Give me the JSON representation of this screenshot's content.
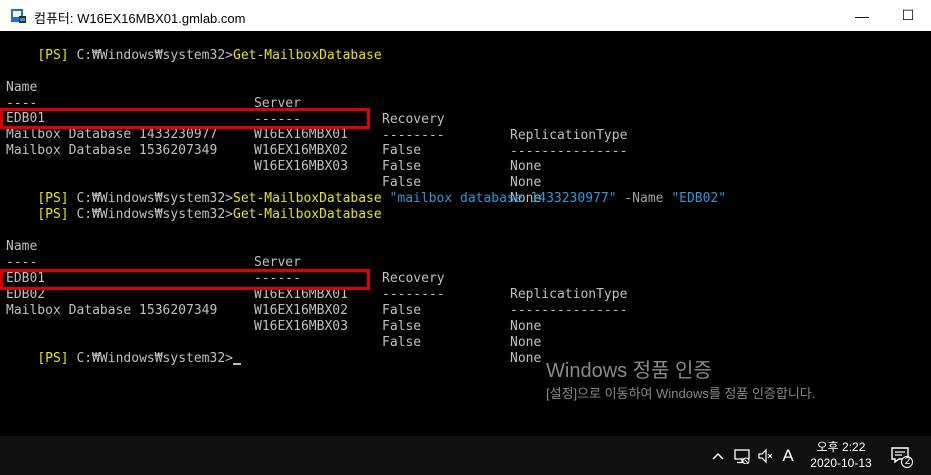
{
  "window": {
    "title": "컴퓨터: W16EX16MBX01.gmlab.com",
    "minimize_glyph": "—",
    "maximize_glyph": "☐"
  },
  "console": {
    "prompt_tag": "[PS]",
    "prompt_path": "C:₩Windows₩system32>",
    "commands": {
      "get_1": "Get-MailboxDatabase",
      "set_cmd": "Set-MailboxDatabase",
      "set_identity": "\"mailbox database 1433230977\"",
      "set_param": "-Name",
      "set_value": "\"EDB02\"",
      "get_2": "Get-MailboxDatabase"
    },
    "headers": {
      "name": "Name",
      "server": "Server",
      "recovery": "Recovery",
      "replication": "ReplicationType",
      "name_rule": "----",
      "server_rule": "------",
      "recovery_rule": "--------",
      "replication_rule": "---------------"
    },
    "table1": [
      {
        "name": "EDB01",
        "server": "W16EX16MBX01",
        "recovery": "False",
        "replication": "None"
      },
      {
        "name": "Mailbox Database 1433230977",
        "server": "W16EX16MBX02",
        "recovery": "False",
        "replication": "None"
      },
      {
        "name": "Mailbox Database 1536207349",
        "server": "W16EX16MBX03",
        "recovery": "False",
        "replication": "None"
      }
    ],
    "table2": [
      {
        "name": "EDB01",
        "server": "W16EX16MBX01",
        "recovery": "False",
        "replication": "None"
      },
      {
        "name": "EDB02",
        "server": "W16EX16MBX02",
        "recovery": "False",
        "replication": "None"
      },
      {
        "name": "Mailbox Database 1536207349",
        "server": "W16EX16MBX03",
        "recovery": "False",
        "replication": "None"
      }
    ],
    "highlight_color": "#e00000"
  },
  "watermark": {
    "title": "Windows 정품 인증",
    "subtitle": "[설정]으로 이동하여 Windows를 정품 인증합니다."
  },
  "taskbar": {
    "tray_chevron": "^",
    "ime_indicator": "A",
    "clock_time": "오후 2:22",
    "clock_date": "2020-10-13",
    "notification_count": "2"
  }
}
